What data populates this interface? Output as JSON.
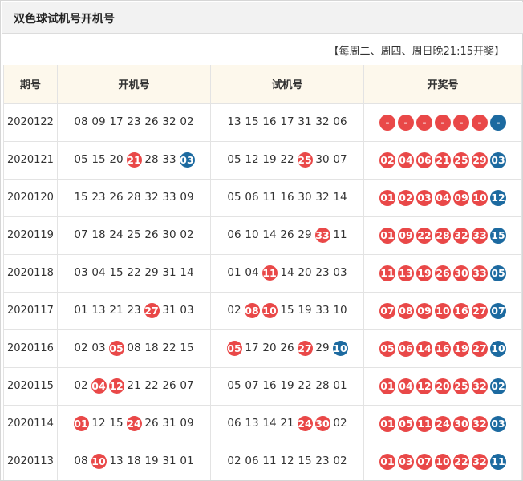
{
  "title": "双色球试机号开机号",
  "note": "【每周二、周四、周日晚21:15开奖】",
  "headers": [
    "期号",
    "开机号",
    "试机号",
    "开奖号"
  ],
  "colors": {
    "red": "#e94848",
    "blue": "#1c6aa0"
  },
  "rows": [
    {
      "issue": "2020122",
      "kaiji": [
        "08",
        "09",
        "17",
        "23",
        "26",
        "32",
        "02"
      ],
      "kaiji_hit": [],
      "shiji": [
        "13",
        "15",
        "16",
        "17",
        "31",
        "32",
        "06"
      ],
      "shiji_hit": [],
      "red": [
        "-",
        "-",
        "-",
        "-",
        "-",
        "-"
      ],
      "blue": "-"
    },
    {
      "issue": "2020121",
      "kaiji": [
        "05",
        "15",
        "20",
        "21",
        "28",
        "33",
        "03"
      ],
      "kaiji_hit": [
        3,
        6
      ],
      "shiji": [
        "05",
        "12",
        "19",
        "22",
        "25",
        "30",
        "07"
      ],
      "shiji_hit": [
        4
      ],
      "red": [
        "02",
        "04",
        "06",
        "21",
        "25",
        "29"
      ],
      "blue": "03"
    },
    {
      "issue": "2020120",
      "kaiji": [
        "15",
        "23",
        "26",
        "28",
        "32",
        "33",
        "09"
      ],
      "kaiji_hit": [],
      "shiji": [
        "05",
        "06",
        "11",
        "16",
        "30",
        "32",
        "14"
      ],
      "shiji_hit": [],
      "red": [
        "01",
        "02",
        "03",
        "04",
        "09",
        "10"
      ],
      "blue": "12"
    },
    {
      "issue": "2020119",
      "kaiji": [
        "07",
        "18",
        "24",
        "25",
        "26",
        "30",
        "02"
      ],
      "kaiji_hit": [],
      "shiji": [
        "06",
        "10",
        "14",
        "26",
        "29",
        "33",
        "11"
      ],
      "shiji_hit": [
        5
      ],
      "red": [
        "01",
        "09",
        "22",
        "28",
        "32",
        "33"
      ],
      "blue": "15"
    },
    {
      "issue": "2020118",
      "kaiji": [
        "03",
        "04",
        "15",
        "22",
        "29",
        "31",
        "14"
      ],
      "kaiji_hit": [],
      "shiji": [
        "01",
        "04",
        "11",
        "14",
        "20",
        "23",
        "03"
      ],
      "shiji_hit": [
        2
      ],
      "red": [
        "11",
        "13",
        "19",
        "26",
        "30",
        "33"
      ],
      "blue": "05"
    },
    {
      "issue": "2020117",
      "kaiji": [
        "01",
        "13",
        "21",
        "23",
        "27",
        "31",
        "03"
      ],
      "kaiji_hit": [
        4
      ],
      "shiji": [
        "02",
        "08",
        "10",
        "15",
        "19",
        "33",
        "10"
      ],
      "shiji_hit": [
        1,
        2
      ],
      "red": [
        "07",
        "08",
        "09",
        "10",
        "16",
        "27"
      ],
      "blue": "07"
    },
    {
      "issue": "2020116",
      "kaiji": [
        "02",
        "03",
        "05",
        "08",
        "18",
        "22",
        "15"
      ],
      "kaiji_hit": [
        2
      ],
      "shiji": [
        "05",
        "17",
        "20",
        "26",
        "27",
        "29",
        "10"
      ],
      "shiji_hit": [
        0,
        4,
        6
      ],
      "red": [
        "05",
        "06",
        "14",
        "16",
        "19",
        "27"
      ],
      "blue": "10"
    },
    {
      "issue": "2020115",
      "kaiji": [
        "02",
        "04",
        "12",
        "21",
        "22",
        "26",
        "07"
      ],
      "kaiji_hit": [
        1,
        2
      ],
      "shiji": [
        "05",
        "07",
        "16",
        "19",
        "22",
        "28",
        "01"
      ],
      "shiji_hit": [],
      "red": [
        "01",
        "04",
        "12",
        "20",
        "25",
        "32"
      ],
      "blue": "02"
    },
    {
      "issue": "2020114",
      "kaiji": [
        "01",
        "12",
        "15",
        "24",
        "26",
        "31",
        "09"
      ],
      "kaiji_hit": [
        0,
        3
      ],
      "shiji": [
        "06",
        "13",
        "14",
        "21",
        "24",
        "30",
        "02"
      ],
      "shiji_hit": [
        4,
        5
      ],
      "red": [
        "01",
        "05",
        "11",
        "24",
        "30",
        "32"
      ],
      "blue": "03"
    },
    {
      "issue": "2020113",
      "kaiji": [
        "08",
        "10",
        "13",
        "18",
        "19",
        "31",
        "01"
      ],
      "kaiji_hit": [
        1
      ],
      "shiji": [
        "02",
        "06",
        "11",
        "12",
        "15",
        "23",
        "02"
      ],
      "shiji_hit": [],
      "red": [
        "01",
        "03",
        "07",
        "10",
        "22",
        "32"
      ],
      "blue": "11"
    }
  ]
}
